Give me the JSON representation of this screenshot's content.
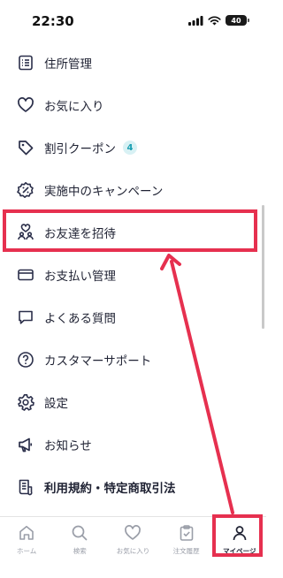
{
  "status_bar": {
    "time": "22:30",
    "battery": "40"
  },
  "menu": {
    "items": [
      {
        "name": "menu-item-address",
        "icon": "list-icon",
        "label": "住所管理"
      },
      {
        "name": "menu-item-favorites",
        "icon": "heart-icon",
        "label": "お気に入り"
      },
      {
        "name": "menu-item-coupons",
        "icon": "tag-icon",
        "label": "割引クーポン",
        "badge": "4"
      },
      {
        "name": "menu-item-campaigns",
        "icon": "percent-badge-icon",
        "label": "実施中のキャンペーン"
      },
      {
        "name": "menu-item-invite-friends",
        "icon": "friends-icon",
        "label": "お友達を招待"
      },
      {
        "name": "menu-item-payment",
        "icon": "credit-card-icon",
        "label": "お支払い管理"
      },
      {
        "name": "menu-item-faq",
        "icon": "chat-bubble-icon",
        "label": "よくある質問"
      },
      {
        "name": "menu-item-support",
        "icon": "help-circle-icon",
        "label": "カスタマーサポート"
      },
      {
        "name": "menu-item-settings",
        "icon": "gear-icon",
        "label": "設定"
      },
      {
        "name": "menu-item-notices",
        "icon": "megaphone-icon",
        "label": "お知らせ"
      },
      {
        "name": "menu-item-terms",
        "icon": "document-icon",
        "label": "利用規約・特定商取引法"
      }
    ]
  },
  "tabbar": {
    "tabs": [
      {
        "label": "ホーム",
        "icon": "home-icon"
      },
      {
        "label": "検索",
        "icon": "search-icon"
      },
      {
        "label": "お気に入り",
        "icon": "heart-icon"
      },
      {
        "label": "注文履歴",
        "icon": "clipboard-icon"
      },
      {
        "label": "マイページ",
        "icon": "person-icon",
        "active": true
      }
    ]
  },
  "colors": {
    "annotation_red": "#e6304f",
    "text": "#1f2233",
    "badge_bg": "#d8f1f4",
    "badge_text": "#1ba0b2",
    "inactive_tab": "#9a9ea8"
  }
}
